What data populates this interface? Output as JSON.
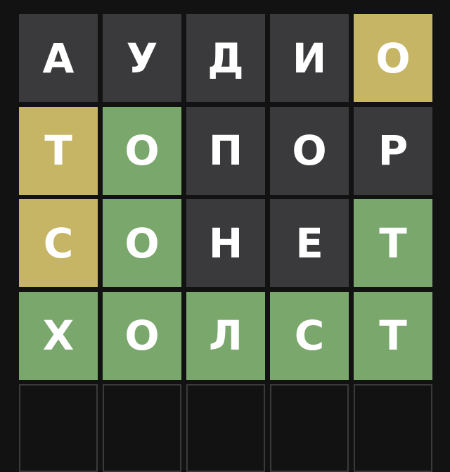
{
  "board": {
    "rows": [
      {
        "tiles": [
          {
            "letter": "А",
            "state": "absent"
          },
          {
            "letter": "У",
            "state": "absent"
          },
          {
            "letter": "Д",
            "state": "absent"
          },
          {
            "letter": "И",
            "state": "absent"
          },
          {
            "letter": "О",
            "state": "present"
          }
        ]
      },
      {
        "tiles": [
          {
            "letter": "Т",
            "state": "present"
          },
          {
            "letter": "О",
            "state": "correct"
          },
          {
            "letter": "П",
            "state": "absent"
          },
          {
            "letter": "О",
            "state": "absent"
          },
          {
            "letter": "Р",
            "state": "absent"
          }
        ]
      },
      {
        "tiles": [
          {
            "letter": "С",
            "state": "present"
          },
          {
            "letter": "О",
            "state": "correct"
          },
          {
            "letter": "Н",
            "state": "absent"
          },
          {
            "letter": "Е",
            "state": "absent"
          },
          {
            "letter": "Т",
            "state": "correct"
          }
        ]
      },
      {
        "tiles": [
          {
            "letter": "Х",
            "state": "correct"
          },
          {
            "letter": "О",
            "state": "correct"
          },
          {
            "letter": "Л",
            "state": "correct"
          },
          {
            "letter": "С",
            "state": "correct"
          },
          {
            "letter": "Т",
            "state": "correct"
          }
        ]
      },
      {
        "tiles": [
          {
            "letter": "",
            "state": "empty"
          },
          {
            "letter": "",
            "state": "empty"
          },
          {
            "letter": "",
            "state": "empty"
          },
          {
            "letter": "",
            "state": "empty"
          },
          {
            "letter": "",
            "state": "empty"
          }
        ]
      }
    ]
  },
  "colors": {
    "background": "#121213",
    "absent": "#3a3a3c",
    "present": "#c5b565",
    "correct": "#79a76c",
    "text": "#ffffff"
  }
}
